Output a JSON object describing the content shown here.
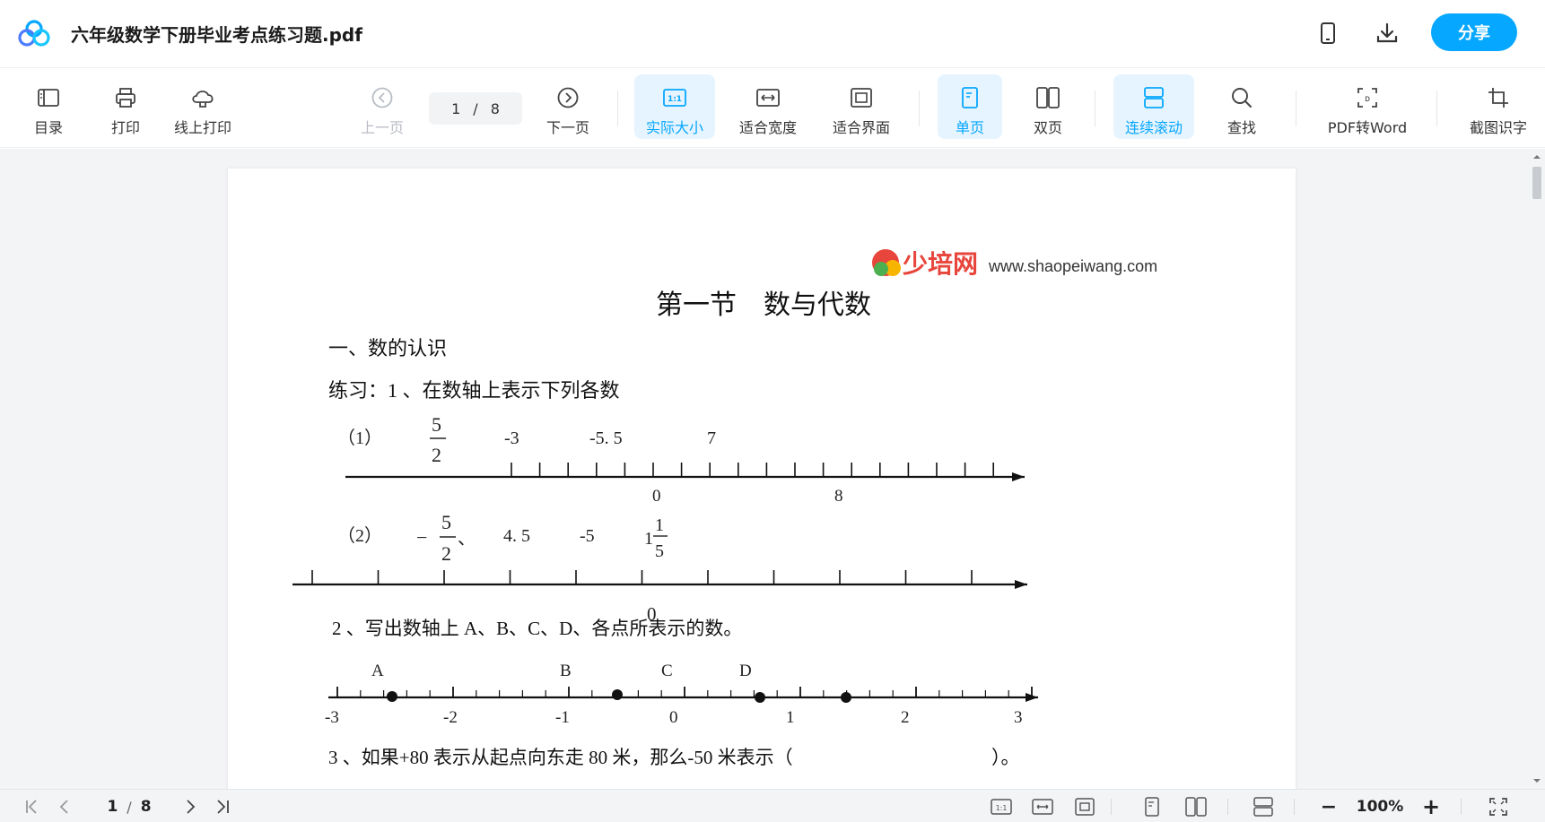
{
  "header": {
    "title": "六年级数学下册毕业考点练习题.pdf",
    "share_label": "分享",
    "icons": [
      "mobile-icon",
      "download-icon"
    ]
  },
  "toolbar": {
    "toc": "目录",
    "print": "打印",
    "online_print": "线上打印",
    "prev_page": "上一页",
    "current_page": "1",
    "page_sep": "/",
    "total_pages": "8",
    "next_page": "下一页",
    "actual_size": "实际大小",
    "fit_width": "适合宽度",
    "fit_page": "适合界面",
    "single_page": "单页",
    "double_page": "双页",
    "continuous_scroll": "连续滚动",
    "search": "查找",
    "pdf_to_word": "PDF转Word",
    "screenshot_ocr": "截图识字",
    "active_items": [
      "实际大小",
      "单页",
      "连续滚动"
    ]
  },
  "document": {
    "watermark_brand": "少培网",
    "watermark_url": "www.shaopeiwang.com",
    "heading": "第一节　数与代数",
    "section1": "一、数的认识",
    "exercise1": "练习：1 、在数轴上表示下列各数",
    "q1_label": "（1）",
    "q1_values": [
      "5",
      "2",
      "-3",
      "-5. 5",
      "7"
    ],
    "q1_axis_labels": [
      "0",
      "8"
    ],
    "q2_label": "（2）",
    "q2_values": [
      "−",
      "5",
      "2",
      "、",
      "4. 5",
      "-5",
      "1",
      "1",
      "5"
    ],
    "q2_axis_labels": [
      "0"
    ],
    "exercise2": "2 、写出数轴上 A、B、C、D、各点所表示的数。",
    "q2b_points": [
      "A",
      "B",
      "C",
      "D"
    ],
    "q2b_axis_labels": [
      "-3",
      "-2",
      "-1",
      "0",
      "1",
      "2",
      "3"
    ],
    "exercise3": "3 、如果+80 表示从起点向东走 80 米，那么-50 米表示（",
    "exercise3_end": "）。"
  },
  "statusbar": {
    "current_page": "1",
    "page_sep": "/",
    "total_pages": "8",
    "zoom": "100%",
    "zoom_minus": "−",
    "zoom_plus": "+"
  },
  "colors": {
    "accent": "#06a7ff",
    "active_bg": "#e6f4ff",
    "disabled": "#b8bcc4",
    "canvas_bg": "#f3f4f6"
  }
}
